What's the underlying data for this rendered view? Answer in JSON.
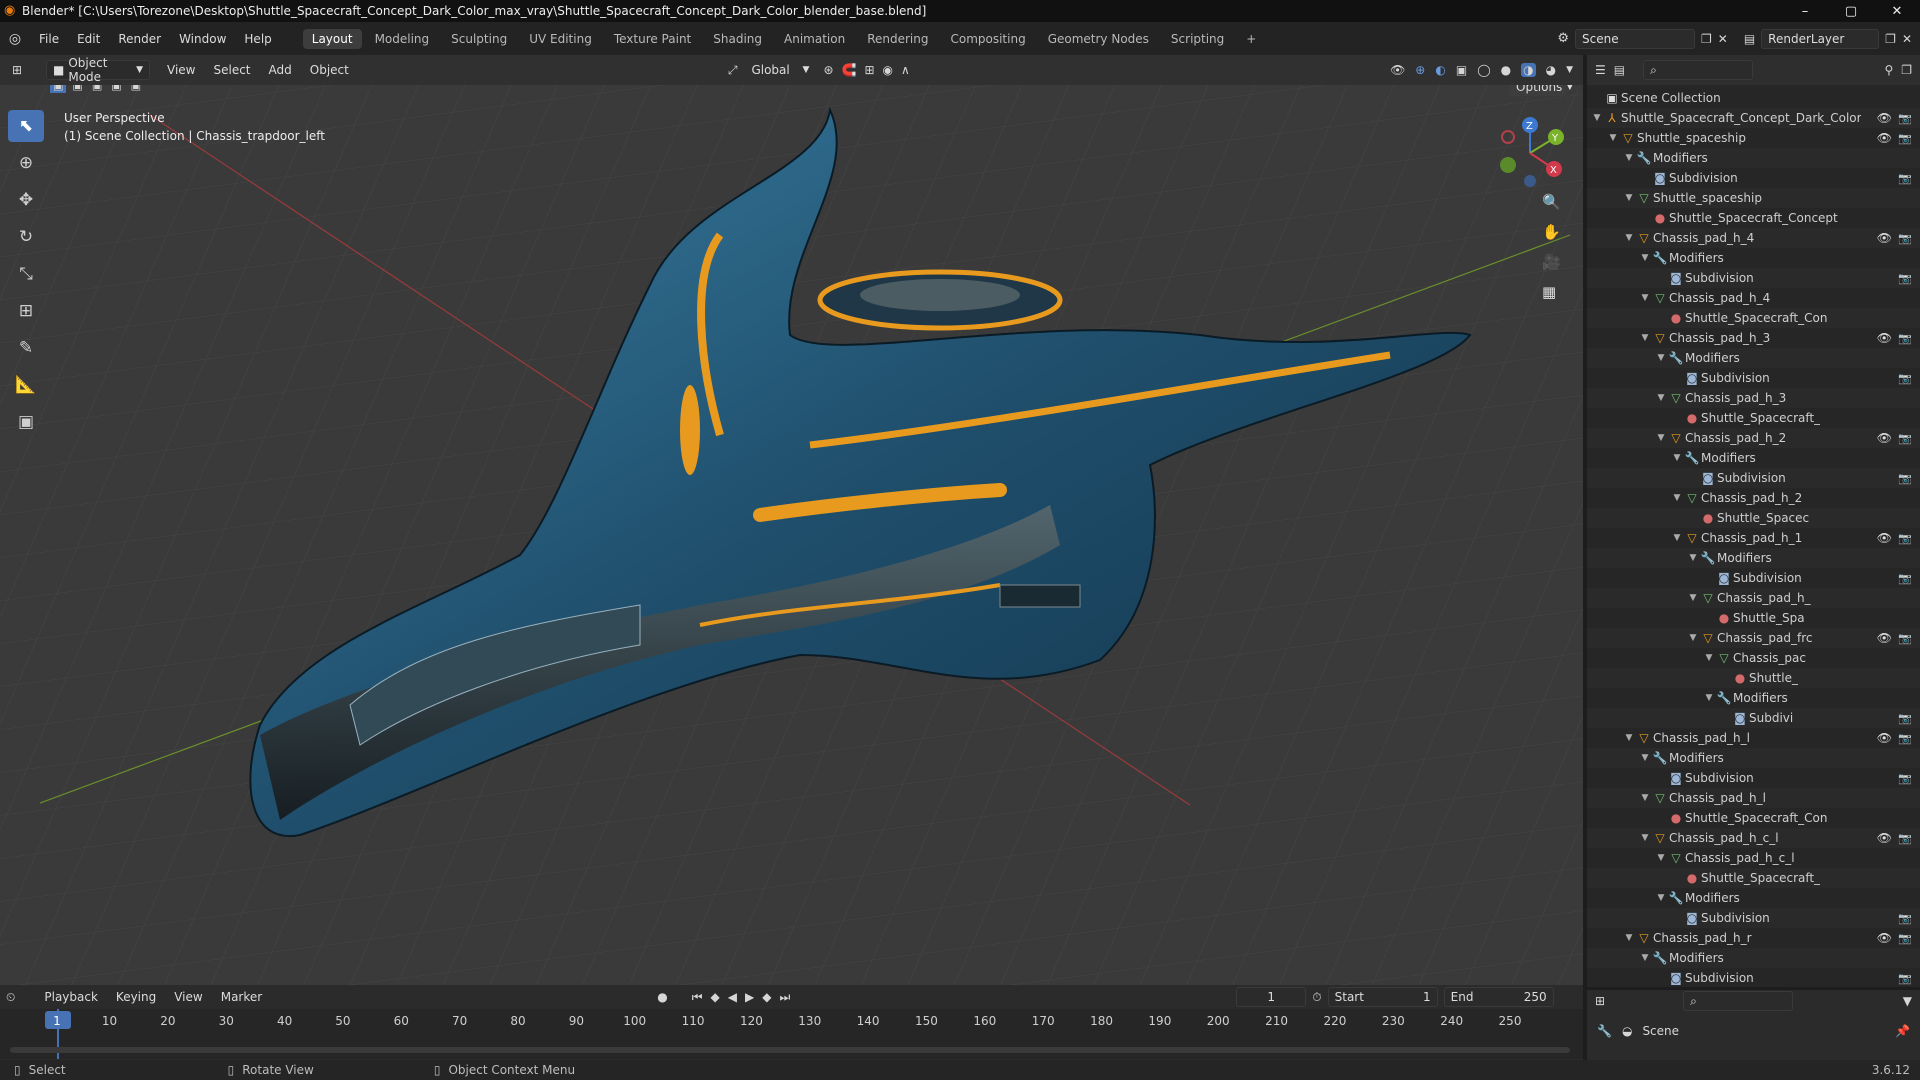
{
  "window": {
    "title": "Blender* [C:\\Users\\Torezone\\Desktop\\Shuttle_Spacecraft_Concept_Dark_Color_max_vray\\Shuttle_Spacecraft_Concept_Dark_Color_blender_base.blend]",
    "minimize": "–",
    "maximize": "▢",
    "close": "✕"
  },
  "menu": {
    "items": [
      "File",
      "Edit",
      "Render",
      "Window",
      "Help"
    ]
  },
  "workspaces": [
    "Layout",
    "Modeling",
    "Sculpting",
    "UV Editing",
    "Texture Paint",
    "Shading",
    "Animation",
    "Rendering",
    "Compositing",
    "Geometry Nodes",
    "Scripting",
    "+"
  ],
  "scene": {
    "label": "Scene",
    "layer": "RenderLayer"
  },
  "viewport_header": {
    "mode": "Object Mode",
    "menus": [
      "View",
      "Select",
      "Add",
      "Object"
    ],
    "orientation": "Global",
    "options": "Options"
  },
  "viewport": {
    "perspective": "User Perspective",
    "context": "(1) Scene Collection | Chassis_trapdoor_left"
  },
  "gizmo": {
    "z": "Z",
    "y": "Y",
    "x": "X"
  },
  "outliner": {
    "rows": [
      {
        "d": 0,
        "t": "",
        "i": "coll",
        "l": "Scene Collection",
        "v": false
      },
      {
        "d": 0,
        "t": "▼",
        "i": "empty",
        "l": "Shuttle_Spacecraft_Concept_Dark_Color",
        "v": true
      },
      {
        "d": 1,
        "t": "▼",
        "i": "obj",
        "l": "Shuttle_spaceship",
        "v": true
      },
      {
        "d": 2,
        "t": "▼",
        "i": "mod",
        "l": "Modifiers",
        "v": false
      },
      {
        "d": 3,
        "t": "",
        "i": "sub",
        "l": "Subdivision",
        "v": false,
        "c": true
      },
      {
        "d": 2,
        "t": "▼",
        "i": "mesh",
        "l": "Shuttle_spaceship",
        "v": false
      },
      {
        "d": 3,
        "t": "",
        "i": "mat",
        "l": "Shuttle_Spacecraft_Concept",
        "v": false
      },
      {
        "d": 2,
        "t": "▼",
        "i": "obj",
        "l": "Chassis_pad_h_4",
        "v": true
      },
      {
        "d": 3,
        "t": "▼",
        "i": "mod",
        "l": "Modifiers",
        "v": false
      },
      {
        "d": 4,
        "t": "",
        "i": "sub",
        "l": "Subdivision",
        "v": false,
        "c": true
      },
      {
        "d": 3,
        "t": "▼",
        "i": "mesh",
        "l": "Chassis_pad_h_4",
        "v": false
      },
      {
        "d": 4,
        "t": "",
        "i": "mat",
        "l": "Shuttle_Spacecraft_Con",
        "v": false
      },
      {
        "d": 3,
        "t": "▼",
        "i": "obj",
        "l": "Chassis_pad_h_3",
        "v": true
      },
      {
        "d": 4,
        "t": "▼",
        "i": "mod",
        "l": "Modifiers",
        "v": false
      },
      {
        "d": 5,
        "t": "",
        "i": "sub",
        "l": "Subdivision",
        "v": false,
        "c": true
      },
      {
        "d": 4,
        "t": "▼",
        "i": "mesh",
        "l": "Chassis_pad_h_3",
        "v": false
      },
      {
        "d": 5,
        "t": "",
        "i": "mat",
        "l": "Shuttle_Spacecraft_",
        "v": false
      },
      {
        "d": 4,
        "t": "▼",
        "i": "obj",
        "l": "Chassis_pad_h_2",
        "v": true
      },
      {
        "d": 5,
        "t": "▼",
        "i": "mod",
        "l": "Modifiers",
        "v": false
      },
      {
        "d": 6,
        "t": "",
        "i": "sub",
        "l": "Subdivision",
        "v": false,
        "c": true
      },
      {
        "d": 5,
        "t": "▼",
        "i": "mesh",
        "l": "Chassis_pad_h_2",
        "v": false
      },
      {
        "d": 6,
        "t": "",
        "i": "mat",
        "l": "Shuttle_Spacec",
        "v": false
      },
      {
        "d": 5,
        "t": "▼",
        "i": "obj",
        "l": "Chassis_pad_h_1",
        "v": true
      },
      {
        "d": 6,
        "t": "▼",
        "i": "mod",
        "l": "Modifiers",
        "v": false
      },
      {
        "d": 7,
        "t": "",
        "i": "sub",
        "l": "Subdivision",
        "v": false,
        "c": true
      },
      {
        "d": 6,
        "t": "▼",
        "i": "mesh",
        "l": "Chassis_pad_h_",
        "v": false
      },
      {
        "d": 7,
        "t": "",
        "i": "mat",
        "l": "Shuttle_Spa",
        "v": false
      },
      {
        "d": 6,
        "t": "▼",
        "i": "obj",
        "l": "Chassis_pad_frc",
        "v": true
      },
      {
        "d": 7,
        "t": "▼",
        "i": "mesh",
        "l": "Chassis_pac",
        "v": false
      },
      {
        "d": 8,
        "t": "",
        "i": "mat",
        "l": "Shuttle_",
        "v": false
      },
      {
        "d": 7,
        "t": "▼",
        "i": "mod",
        "l": "Modifiers",
        "v": false
      },
      {
        "d": 8,
        "t": "",
        "i": "sub",
        "l": "Subdivi",
        "v": false,
        "c": true
      },
      {
        "d": 2,
        "t": "▼",
        "i": "obj",
        "l": "Chassis_pad_h_l",
        "v": true
      },
      {
        "d": 3,
        "t": "▼",
        "i": "mod",
        "l": "Modifiers",
        "v": false
      },
      {
        "d": 4,
        "t": "",
        "i": "sub",
        "l": "Subdivision",
        "v": false,
        "c": true
      },
      {
        "d": 3,
        "t": "▼",
        "i": "mesh",
        "l": "Chassis_pad_h_l",
        "v": false
      },
      {
        "d": 4,
        "t": "",
        "i": "mat",
        "l": "Shuttle_Spacecraft_Con",
        "v": false
      },
      {
        "d": 3,
        "t": "▼",
        "i": "obj",
        "l": "Chassis_pad_h_c_l",
        "v": true
      },
      {
        "d": 4,
        "t": "▼",
        "i": "mesh",
        "l": "Chassis_pad_h_c_l",
        "v": false
      },
      {
        "d": 5,
        "t": "",
        "i": "mat",
        "l": "Shuttle_Spacecraft_",
        "v": false
      },
      {
        "d": 4,
        "t": "▼",
        "i": "mod",
        "l": "Modifiers",
        "v": false
      },
      {
        "d": 5,
        "t": "",
        "i": "sub",
        "l": "Subdivision",
        "v": false,
        "c": true
      },
      {
        "d": 2,
        "t": "▼",
        "i": "obj",
        "l": "Chassis_pad_h_r",
        "v": true
      },
      {
        "d": 3,
        "t": "▼",
        "i": "mod",
        "l": "Modifiers",
        "v": false
      },
      {
        "d": 4,
        "t": "",
        "i": "sub",
        "l": "Subdivision",
        "v": false,
        "c": true
      }
    ]
  },
  "properties": {
    "label": "Scene"
  },
  "timeline": {
    "menus": [
      "Playback",
      "Keying",
      "View",
      "Marker"
    ],
    "current": "1",
    "start_label": "Start",
    "start": "1",
    "end_label": "End",
    "end": "250",
    "ticks": [
      "1",
      "10",
      "20",
      "30",
      "40",
      "50",
      "60",
      "70",
      "80",
      "90",
      "100",
      "110",
      "120",
      "130",
      "140",
      "150",
      "160",
      "170",
      "180",
      "190",
      "200",
      "210",
      "220",
      "230",
      "240",
      "250"
    ]
  },
  "status": {
    "select": "Select",
    "rotate": "Rotate View",
    "context": "Object Context Menu",
    "version": "3.6.12"
  },
  "colors": {
    "accent": "#4772b3",
    "hull": "#1d4a63",
    "trim": "#e89a1f"
  }
}
